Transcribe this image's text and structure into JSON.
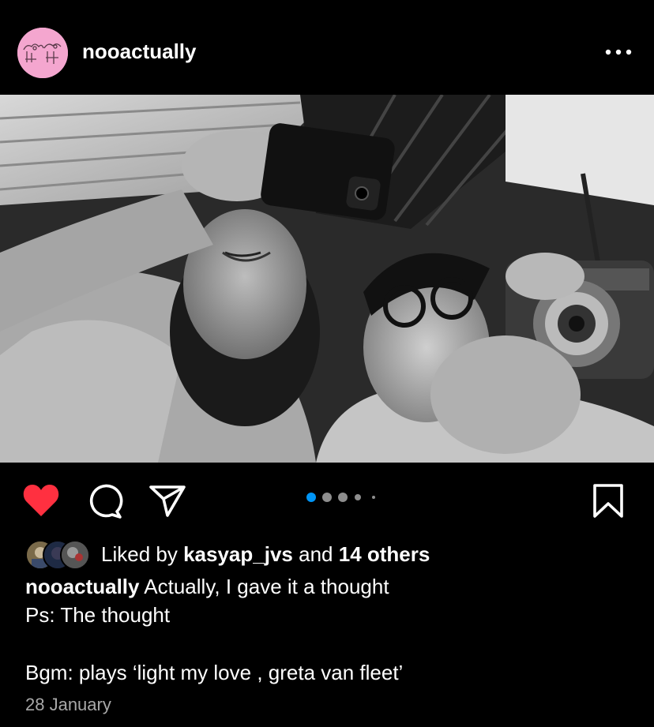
{
  "post": {
    "username": "nooactually",
    "more_label": "•••"
  },
  "actions": {
    "liked": true,
    "carousel_pages": 5,
    "carousel_current": 1
  },
  "likes": {
    "prefix": "Liked by",
    "liker": "kasyap_jvs",
    "connector": "and",
    "others": "14 others"
  },
  "caption": {
    "username": "nooactually",
    "line1": "Actually, I gave it a thought",
    "line2": "Ps: The thought",
    "line3": "Bgm: plays ‘light my love , greta van fleet’"
  },
  "date": "28 January",
  "colors": {
    "background": "#000000",
    "like_red": "#ff3040",
    "dot_active": "#0095f6",
    "avatar_pink": "#f4a6cf",
    "muted_text": "#a8a8a8"
  },
  "icons": [
    "heart-icon",
    "comment-icon",
    "share-icon",
    "bookmark-icon",
    "more-icon"
  ]
}
